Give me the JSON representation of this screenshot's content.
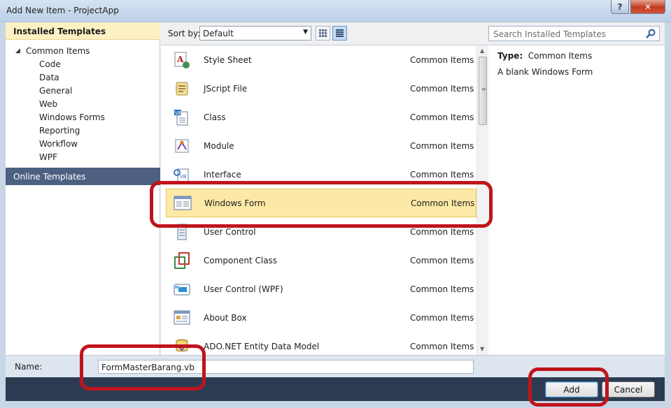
{
  "window": {
    "title": "Add New Item - ProjectApp",
    "help_label": "?",
    "close_label": "✕"
  },
  "left": {
    "installed_header": "Installed Templates",
    "tree_root": "Common Items",
    "tree_children": [
      "Code",
      "Data",
      "General",
      "Web",
      "Windows Forms",
      "Reporting",
      "Workflow",
      "WPF"
    ],
    "online_header": "Online Templates"
  },
  "toolbar": {
    "sort_label": "Sort by:",
    "sort_value": "Default"
  },
  "search": {
    "placeholder": "Search Installed Templates"
  },
  "templates": [
    {
      "name": "Style Sheet",
      "category": "Common Items",
      "icon": "style-sheet-icon"
    },
    {
      "name": "JScript File",
      "category": "Common Items",
      "icon": "jscript-file-icon"
    },
    {
      "name": "Class",
      "category": "Common Items",
      "icon": "class-icon"
    },
    {
      "name": "Module",
      "category": "Common Items",
      "icon": "module-icon"
    },
    {
      "name": "Interface",
      "category": "Common Items",
      "icon": "interface-icon"
    },
    {
      "name": "Windows Form",
      "category": "Common Items",
      "icon": "windows-form-icon",
      "selected": true
    },
    {
      "name": "User Control",
      "category": "Common Items",
      "icon": "user-control-icon"
    },
    {
      "name": "Component Class",
      "category": "Common Items",
      "icon": "component-class-icon"
    },
    {
      "name": "User Control (WPF)",
      "category": "Common Items",
      "icon": "wpf-user-control-icon"
    },
    {
      "name": "About Box",
      "category": "Common Items",
      "icon": "about-box-icon"
    },
    {
      "name": "ADO.NET Entity Data Model",
      "category": "Common Items",
      "icon": "entity-model-icon"
    }
  ],
  "details": {
    "type_label": "Type:",
    "type_value": "Common Items",
    "description": "A blank Windows Form"
  },
  "name_field": {
    "label": "Name:",
    "value": "FormMasterBarang.vb"
  },
  "buttons": {
    "add": "Add",
    "cancel": "Cancel"
  },
  "colors": {
    "selection": "#fde9a6",
    "annotation": "#c0141c",
    "online_header": "#4d6082",
    "button_bar": "#2d3b52"
  }
}
